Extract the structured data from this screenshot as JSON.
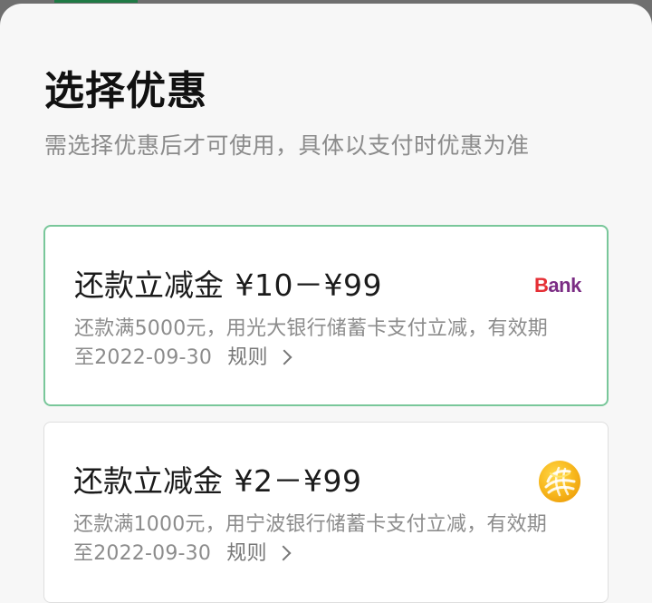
{
  "sheet": {
    "title": "选择优惠",
    "subtitle": "需选择优惠后才可使用，具体以支付时优惠为准"
  },
  "coupons": [
    {
      "label": "还款立减金",
      "amount": "¥10－¥99",
      "description_line_1": "还款满5000元，用光大银行储蓄卡支付立减，有效期",
      "expiry": "至2022-09-30",
      "rule_label": "规则",
      "selected": true,
      "logo_text_first": "B",
      "logo_text_rest": "ank",
      "logo_icon": "bank-icon"
    },
    {
      "label": "还款立减金",
      "amount": "¥2－¥99",
      "description_line_1": "还款满1000元，用宁波银行储蓄卡支付立减，有效期",
      "expiry": "至2022-09-30",
      "rule_label": "规则",
      "selected": false,
      "logo_icon": "round-bank-icon"
    }
  ],
  "colors": {
    "selected_border": "#79c79a",
    "accent": "#1f7a45",
    "title_text": "#111111",
    "secondary_text": "#8b8b8b"
  }
}
